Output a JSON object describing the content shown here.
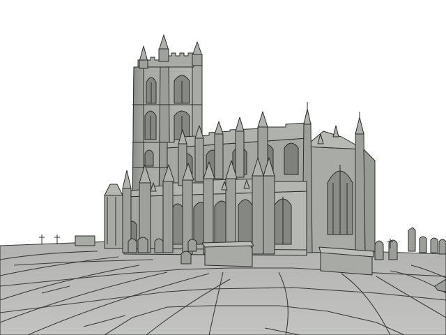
{
  "scene": {
    "subject": "cathedral-wireframe-render",
    "colors": {
      "background": "#ffffff",
      "stone_light": "#b4b6b2",
      "stone_mid": "#9a9c98",
      "stone_dark": "#6f716d",
      "window_dark": "#7c7e7a",
      "edge": "#2b2c2a",
      "ground": "#b9bab7",
      "ground_edge": "#3a3b39"
    }
  }
}
